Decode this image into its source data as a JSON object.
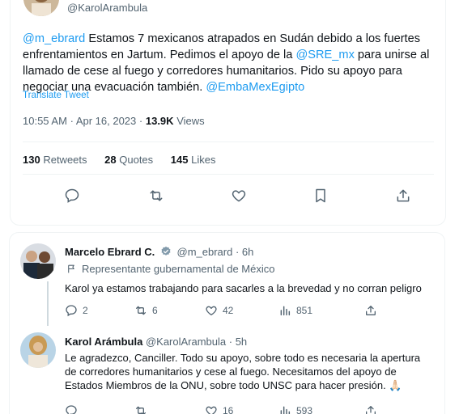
{
  "main_tweet": {
    "handle": "@KarolArambula",
    "text_parts": {
      "mention1": "@m_ebrard",
      "t1": " Estamos 7 mexicanos atrapados en Sudán debido a los fuertes enfrentamientos en Jartum. Pedimos el apoyo de la ",
      "mention2": "@SRE_mx",
      "t2": " para unirse al llamado de cese al fuego y corredores humanitarios. Pido su apoyo para negociar una evacuación también. ",
      "mention3": "@EmbaMexEgipto"
    },
    "translate": "Translate Tweet",
    "time": "10:55 AM",
    "date": "Apr 16, 2023",
    "views_count": "13.9K",
    "views_label": "Views",
    "dot": "·",
    "retweets_count": "130",
    "retweets_label": "Retweets",
    "quotes_count": "28",
    "quotes_label": "Quotes",
    "likes_count": "145",
    "likes_label": "Likes"
  },
  "replies": [
    {
      "name": "Marcelo Ebrard C.",
      "handle": "@m_ebrard",
      "time": "· 6h",
      "label": "Representante gubernamental de México",
      "text": "Karol ya estamos trabajando para sacarles a la brevedad y no corran peligro",
      "replies": "2",
      "retweets": "6",
      "likes": "42",
      "views": "851"
    },
    {
      "name": "Karol Arámbula",
      "handle": "@KarolArambula",
      "time": "· 5h",
      "text": "Le agradezco, Canciller. Todo su apoyo, sobre todo es necesaria la apertura de corredores humanitarios y cese al fuego. Necesitamos del apoyo de Estados Miembros de la ONU, sobre todo UNSC para hacer presión. 🙏🏻",
      "replies": "",
      "retweets": "",
      "likes": "16",
      "views": "593"
    }
  ],
  "colors": {
    "accent": "#1d9bf0",
    "secondary": "#536471",
    "text": "#0f1419",
    "verified": "#829aab"
  }
}
